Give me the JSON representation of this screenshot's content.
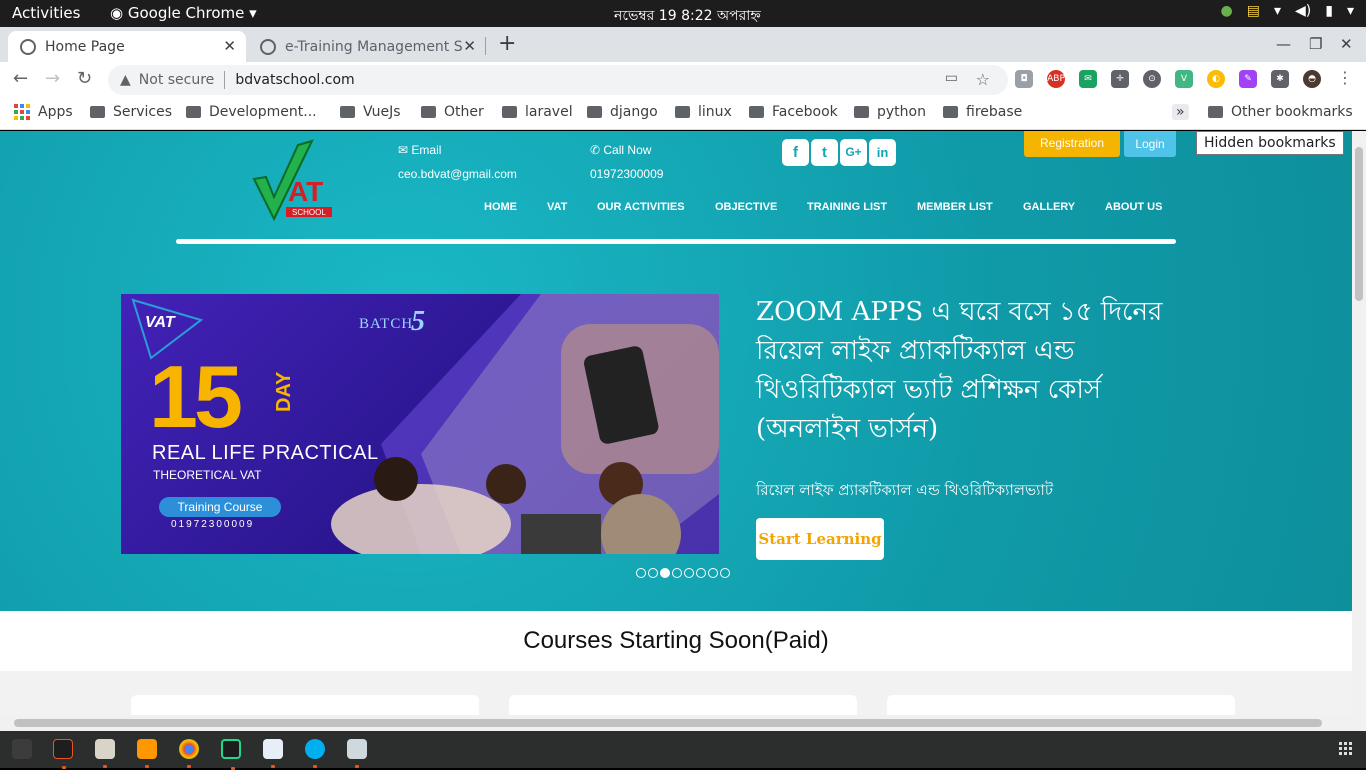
{
  "system": {
    "activities": "Activities",
    "app_name": "Google Chrome",
    "clock": "নভেম্বর 19  8:22 অপরাহ্ন"
  },
  "tabs": [
    {
      "title": "Home Page",
      "active": true
    },
    {
      "title": "e-Training Management S",
      "active": false
    }
  ],
  "address_bar": {
    "security_label": "Not secure",
    "url": "bdvatschool.com"
  },
  "bookmarks": {
    "apps_label": "Apps",
    "items": [
      "Services",
      "Development...",
      "VueJs",
      "Other",
      "laravel",
      "django",
      "linux",
      "Facebook",
      "python",
      "firebase"
    ],
    "more": "»",
    "other": "Other bookmarks",
    "tooltip": "Hidden bookmarks"
  },
  "site": {
    "header": {
      "email_label": "Email",
      "email_value": "ceo.bdvat@gmail.com",
      "call_label": "Call Now",
      "call_value": "01972300009",
      "register": "Registration",
      "login": "Login",
      "logo_text": "AT",
      "logo_sub": "SCHOOL"
    },
    "social": [
      "f",
      "t",
      "G+",
      "in"
    ],
    "menu": [
      "HOME",
      "VAT",
      "OUR ACTIVITIES",
      "OBJECTIVE",
      "TRAINING LIST",
      "MEMBER LIST",
      "GALLERY",
      "ABOUT US"
    ],
    "banner": {
      "brand": "VAT",
      "batch": "BATCH",
      "batch_no": "5",
      "days": "15",
      "day_word": "DAY",
      "line1": "REAL LIFE PRACTICAL",
      "line2": "THEORETICAL VAT",
      "course": "Training Course",
      "phone": "01972300009"
    },
    "hero": {
      "title": "ZOOM APPS এ ঘরে বসে ১৫ দিনের রিয়েল লাইফ প্র্যাকটিক্যাল এন্ড থিওরিটিক্যাল ভ্যাট প্রশিক্ষন কোর্স (অনলাইন ভার্সন)",
      "subtitle": "রিয়েল লাইফ প্র্যাকটিক্যাল এন্ড থিওরিটিক্যালভ্যাট",
      "cta": "Start Learning"
    },
    "slider": {
      "count": 8,
      "active_index": 2
    },
    "section_title": "Courses Starting Soon(Paid)"
  },
  "colors": {
    "hero_bg": "#13a6b5",
    "register_btn": "#f4b400",
    "login_btn": "#4fc3e8",
    "cta_text": "#f4a400"
  }
}
